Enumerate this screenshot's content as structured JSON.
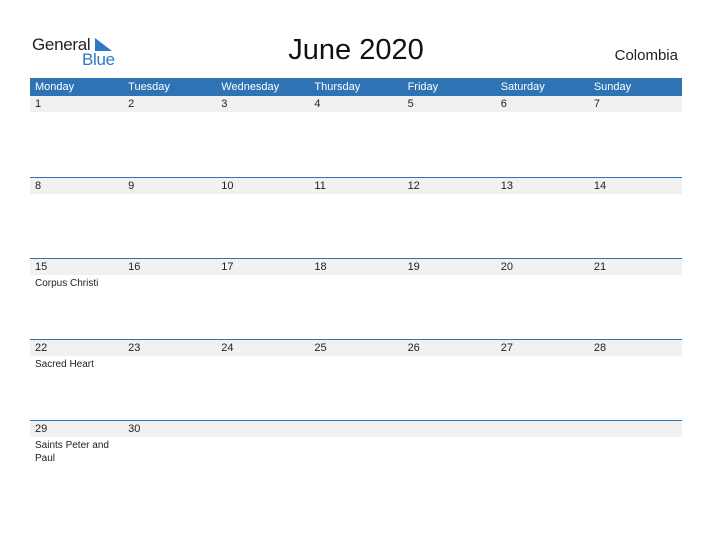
{
  "logo": {
    "word1": "General",
    "word2": "Blue"
  },
  "title": "June 2020",
  "country": "Colombia",
  "weekdays": [
    "Monday",
    "Tuesday",
    "Wednesday",
    "Thursday",
    "Friday",
    "Saturday",
    "Sunday"
  ],
  "weeks": [
    {
      "days": [
        "1",
        "2",
        "3",
        "4",
        "5",
        "6",
        "7"
      ],
      "events": [
        "",
        "",
        "",
        "",
        "",
        "",
        ""
      ]
    },
    {
      "days": [
        "8",
        "9",
        "10",
        "11",
        "12",
        "13",
        "14"
      ],
      "events": [
        "",
        "",
        "",
        "",
        "",
        "",
        ""
      ]
    },
    {
      "days": [
        "15",
        "16",
        "17",
        "18",
        "19",
        "20",
        "21"
      ],
      "events": [
        "Corpus Christi",
        "",
        "",
        "",
        "",
        "",
        ""
      ]
    },
    {
      "days": [
        "22",
        "23",
        "24",
        "25",
        "26",
        "27",
        "28"
      ],
      "events": [
        "Sacred Heart",
        "",
        "",
        "",
        "",
        "",
        ""
      ]
    },
    {
      "days": [
        "29",
        "30",
        "",
        "",
        "",
        "",
        ""
      ],
      "events": [
        "Saints Peter and Paul",
        "",
        "",
        "",
        "",
        "",
        ""
      ]
    }
  ],
  "colors": {
    "header": "#2e74b5",
    "brand_blue": "#2d7bc4",
    "band": "#f1f1f1"
  }
}
